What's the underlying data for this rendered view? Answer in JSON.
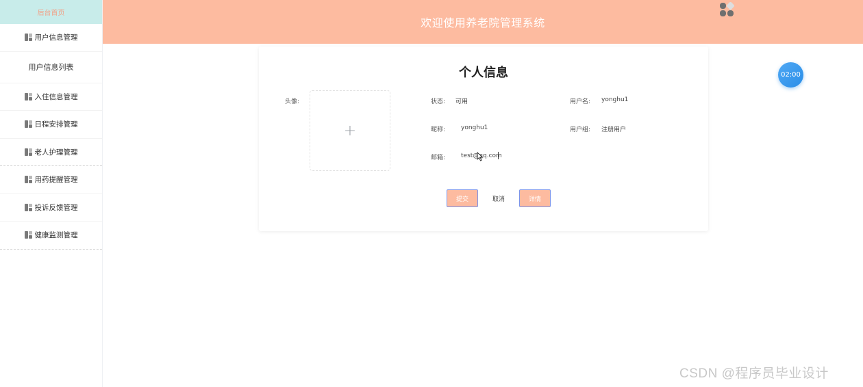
{
  "sidebar": {
    "home_label": "后台首页",
    "items": [
      {
        "label": "用户信息管理",
        "icon": "grid-icon"
      },
      {
        "label": "用户信息列表",
        "sub": true
      },
      {
        "label": "入住信息管理",
        "icon": "grid-icon"
      },
      {
        "label": "日程安排管理",
        "icon": "grid-icon"
      },
      {
        "label": "老人护理管理",
        "icon": "grid-icon"
      },
      {
        "label": "用药提醒管理",
        "icon": "grid-icon"
      },
      {
        "label": "投诉反馈管理",
        "icon": "grid-icon"
      },
      {
        "label": "健康监测管理",
        "icon": "grid-icon"
      }
    ]
  },
  "header": {
    "title": "欢迎使用养老院管理系统"
  },
  "profile": {
    "title": "个人信息",
    "avatar_label": "头像:",
    "status_label": "状态:",
    "status_value": "可用",
    "username_label": "用户名:",
    "username_value": "yonghu1",
    "nickname_label": "昵称:",
    "nickname_value": "yonghu1",
    "group_label": "用户组:",
    "group_value": "注册用户",
    "email_label": "邮箱:",
    "email_value": "test@qq.com"
  },
  "buttons": {
    "submit": "提交",
    "cancel": "取消",
    "detail": "详情"
  },
  "timer": "02:00",
  "watermark": "CSDN @程序员毕业设计",
  "colors": {
    "header_bg": "#fdbba0",
    "sidebar_home_bg": "#c8ecea",
    "timer_bg": "#3a9cf0",
    "button_border": "#7b93e8"
  }
}
